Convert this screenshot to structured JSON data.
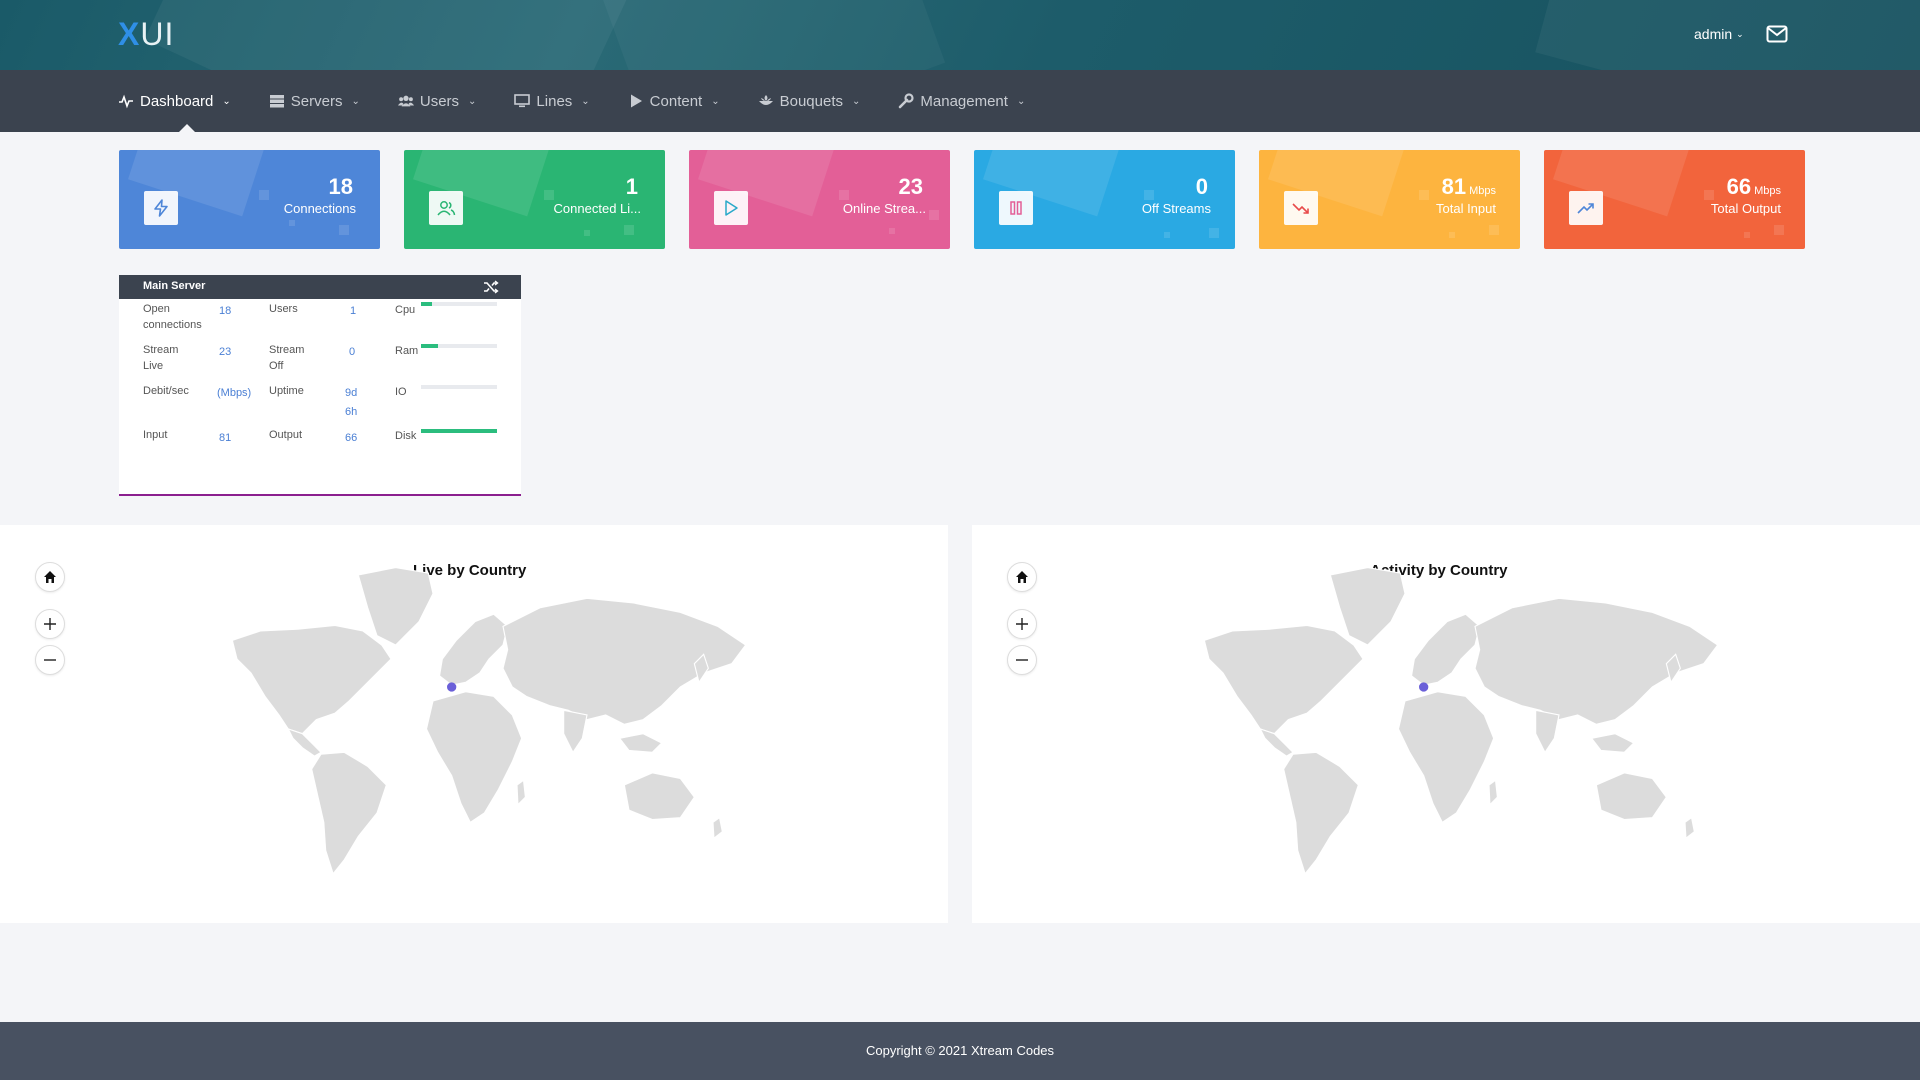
{
  "app": {
    "logo_x": "X",
    "logo_ui": "UI",
    "user": "admin"
  },
  "nav": [
    {
      "label": "Dashboard",
      "icon": "pulse-icon",
      "active": true
    },
    {
      "label": "Servers",
      "icon": "server-icon"
    },
    {
      "label": "Users",
      "icon": "users-icon"
    },
    {
      "label": "Lines",
      "icon": "monitor-icon"
    },
    {
      "label": "Content",
      "icon": "play-icon"
    },
    {
      "label": "Bouquets",
      "icon": "bouquet-icon"
    },
    {
      "label": "Management",
      "icon": "wrench-icon"
    }
  ],
  "cards": [
    {
      "value": "18",
      "unit": "",
      "label": "Connections",
      "color": "#4e86d8",
      "icon": "bolt-icon"
    },
    {
      "value": "1",
      "unit": "",
      "label": "Connected Li...",
      "color": "#2ab573",
      "icon": "users-icon"
    },
    {
      "value": "23",
      "unit": "",
      "label": "Online Strea...",
      "color": "#e35f97",
      "icon": "play-icon"
    },
    {
      "value": "0",
      "unit": "",
      "label": "Off Streams",
      "color": "#2aa9e3",
      "icon": "pause-icon"
    },
    {
      "value": "81",
      "unit": "Mbps",
      "label": "Total Input",
      "color": "#fdb43f",
      "icon": "trend-down-icon"
    },
    {
      "value": "66",
      "unit": "Mbps",
      "label": "Total Output",
      "color": "#f2643c",
      "icon": "trend-up-icon"
    }
  ],
  "server": {
    "title": "Main Server",
    "open_connections_label": "Open connections",
    "open_connections": "18",
    "users_label": "Users",
    "users": "1",
    "stream_live_label": "Stream Live",
    "stream_live": "23",
    "stream_off_label": "Stream Off",
    "stream_off": "0",
    "debit_label": "Debit/sec",
    "debit_unit": "(Mbps)",
    "uptime_label": "Uptime",
    "uptime_days": "9d",
    "uptime_hours": "6h",
    "input_label": "Input",
    "input": "81",
    "output_label": "Output",
    "output": "66",
    "cpu_label": "Cpu",
    "cpu_pct": 15,
    "ram_label": "Ram",
    "ram_pct": 22,
    "io_label": "IO",
    "io_pct": 0,
    "disk_label": "Disk",
    "disk_pct": 100
  },
  "maps": {
    "live_title": "Live by Country",
    "activity_title": "Activity by Country"
  },
  "footer": {
    "copyright": "Copyright © 2021 Xtream Codes"
  }
}
